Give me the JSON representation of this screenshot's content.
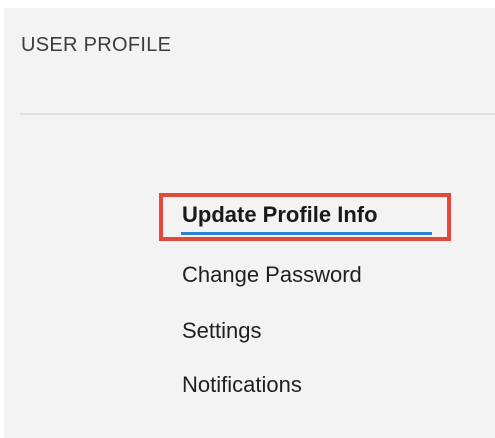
{
  "header": {
    "title": "USER PROFILE"
  },
  "menu": {
    "items": [
      {
        "label": "Update Profile Info",
        "active": true
      },
      {
        "label": "Change Password",
        "active": false
      },
      {
        "label": "Settings",
        "active": false
      },
      {
        "label": "Notifications",
        "active": false
      }
    ]
  },
  "colors": {
    "background": "#f3f3f3",
    "highlight_border": "#e2493a",
    "active_underline": "#2f7fd6",
    "text": "#1f1f1f"
  }
}
